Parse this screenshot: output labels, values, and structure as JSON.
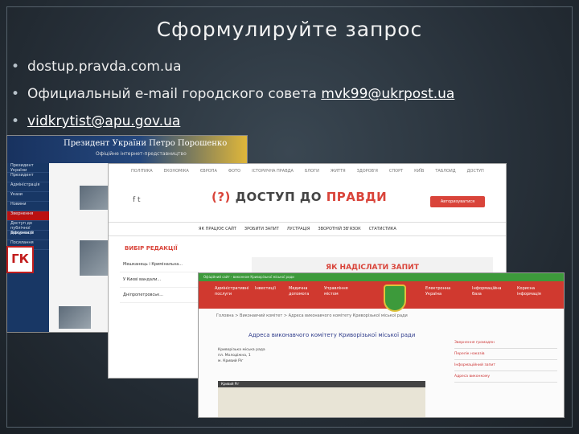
{
  "slide": {
    "title": "Сформулируйте запрос",
    "bullets": [
      {
        "text": "dostup.pravda.com.ua",
        "link": false
      },
      {
        "prefix": "Официальный e-mail городского совета ",
        "link_text": "mvk99@ukrpost.ua",
        "link": true
      },
      {
        "text": "vidkrytist@apu.gov.ua",
        "link": true
      }
    ],
    "bullet_symbol": "•"
  },
  "screenshot_president": {
    "header_title": "Президент України Петро Порошенко",
    "header_subtitle": "Офіційне інтернет-представництво",
    "side_title": "Президент України",
    "side_items": [
      "Президент",
      "Адміністрація",
      "Укази",
      "Новини",
      "Звернення",
      "Доступ до публічної інформації",
      "Документи",
      "Посилання"
    ],
    "logo_text": "ГК"
  },
  "screenshot_dostup": {
    "nav": [
      "ПОЛІТИКА",
      "ЕКОНОМІКА",
      "ЄВРОПА",
      "ФОТО",
      "ІСТОРИЧНА ПРАВДА",
      "БЛОГИ",
      "ЖИТТЯ",
      "ЗДОРОВ'Я",
      "СПОРТ",
      "КИЇВ",
      "ТАБЛОИД",
      "ДОСТУП"
    ],
    "logo_text": "ДОСТУП ДО ",
    "logo_accent": "ПРАВДИ",
    "logo_prefix": "(?)",
    "social": "f  t",
    "login_button": "Авторизуватися",
    "menu": [
      "ЯК ПРАЦЮЄ САЙТ",
      "ЗРОБИТИ ЗАПИТ",
      "ЛУСТРАЦІЯ",
      "ЗВОРОТНІЙ ЗВ'ЯЗОК",
      "СТАТИСТИКА"
    ],
    "section_title": "ВИБІР РЕДАКЦІЇ",
    "ask_banner": "ЯК НАДІСЛАТИ ЗАПИТ",
    "left_items": [
      "Мешканець і Кримінальна...",
      "У Києві вандали...",
      "Дніпропетровськ..."
    ]
  },
  "screenshot_kryvyi": {
    "top_bar": "Офіційний сайт - виконком Криворізької міської ради",
    "red_menu": [
      "Адміністративні послуги",
      "Інвестиції",
      "Медична допомога",
      "Управління містом",
      "Електронна Україна",
      "Інформаційна база",
      "Корисна інформація"
    ],
    "breadcrumb": "Головна > Виконавчий комітет > Адреса виконавчого комітету Криворізької міської ради",
    "heading": "Адреса виконавчого комітету Криворізької міської ради",
    "address_lines": [
      "Криворізька міська рада",
      "пл. Молодіжна, 1",
      "м. Кривий Ріг"
    ],
    "map_label": "Кривий Ріг",
    "right_links": [
      "Звернення громадян",
      "Перелік наказів",
      "Інформаційний запит",
      "Адреса виконкому"
    ]
  },
  "colors": {
    "background": "#273039",
    "dostup_red": "#d9443a",
    "kryvyi_red": "#d0392f",
    "kryvyi_green": "#3d9a3b",
    "president_blue": "#183765"
  }
}
